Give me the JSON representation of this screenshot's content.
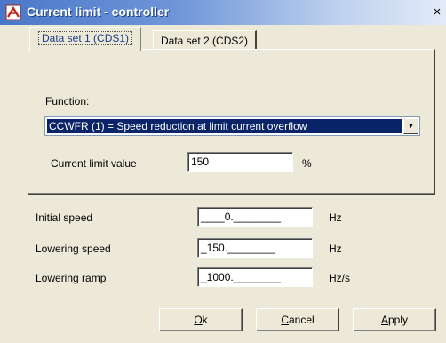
{
  "window": {
    "title": "Current limit - controller",
    "close": "×"
  },
  "tabs": [
    {
      "label": "Data set 1 (CDS1)",
      "active": true
    },
    {
      "label": "Data set 2 (CDS2)",
      "active": false
    }
  ],
  "function": {
    "label": "Function:",
    "selected": "CCWFR (1) = Speed reduction at limit current overflow"
  },
  "current_limit": {
    "label": "Current limit value",
    "value": "150",
    "unit": "%"
  },
  "params": [
    {
      "label": "Initial speed",
      "value": "____0.________",
      "unit": "Hz"
    },
    {
      "label": "Lowering speed",
      "value": "_150.________",
      "unit": "Hz"
    },
    {
      "label": "Lowering ramp",
      "value": "_1000.________",
      "unit": "Hz/s"
    }
  ],
  "buttons": {
    "ok": {
      "accel": "O",
      "rest": "k"
    },
    "cancel": {
      "accel": "C",
      "rest": "ancel"
    },
    "apply": {
      "accel": "A",
      "rest": "pply"
    }
  },
  "colors": {
    "selection": "#0a246a",
    "dialog_bg": "#ece9d8",
    "title_start": "#4a78c8"
  }
}
